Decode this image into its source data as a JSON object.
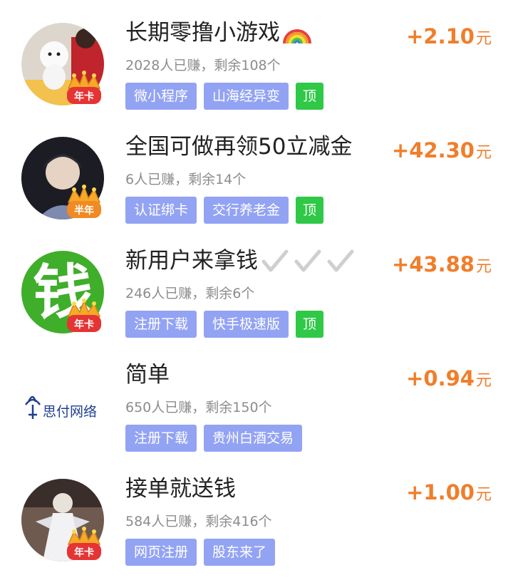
{
  "colors": {
    "reward": "#f07e2a",
    "tag": "#93a3f4",
    "top_tag": "#30c847"
  },
  "tasks": [
    {
      "title": "长期零撸小游戏",
      "title_emoji": "rainbow-icon",
      "stats": "2028人已赚，剩余108个",
      "tags": [
        "微小程序",
        "山海经异变"
      ],
      "top_label": "顶",
      "reward": "+2.10",
      "unit": "元",
      "badge": "年卡"
    },
    {
      "title": "全国可做再领50立减金",
      "stats": "6人已赚，剩余14个",
      "tags": [
        "认证绑卡",
        "交行养老金"
      ],
      "top_label": "顶",
      "reward": "+42.30",
      "unit": "元",
      "badge": "半年"
    },
    {
      "title": "新用户来拿钱",
      "title_emoji": "check-marks-icon",
      "stats": "246人已赚，剩余6个",
      "tags": [
        "注册下载",
        "快手极速版"
      ],
      "top_label": "顶",
      "reward": "+43.88",
      "unit": "元",
      "badge": "年卡",
      "avatar_text": "钱"
    },
    {
      "title": "简单",
      "stats": "650人已赚，剩余150个",
      "tags": [
        "注册下载",
        "贵州白酒交易"
      ],
      "reward": "+0.94",
      "unit": "元",
      "avatar_text": "思付网络"
    },
    {
      "title": "接单就送钱",
      "stats": "584人已赚，剩余416个",
      "tags": [
        "网页注册",
        "股东来了"
      ],
      "reward": "+1.00",
      "unit": "元",
      "badge": "年卡"
    }
  ]
}
